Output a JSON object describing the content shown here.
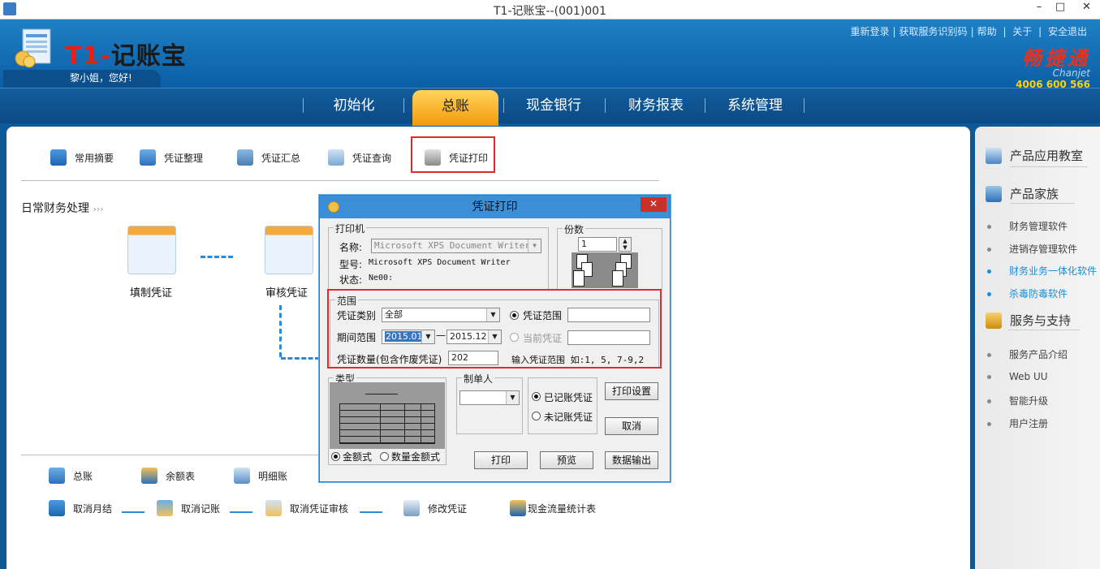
{
  "window": {
    "title": "T1-记账宝--(001)001",
    "minimize": "–",
    "maximize": "□",
    "close": "✕"
  },
  "header": {
    "brand_t1": "T1-",
    "brand_cn": "记账宝",
    "greeting": "黎小姐，您好!",
    "links": [
      "重新登录",
      "获取服务识别码",
      "帮助",
      "关于",
      "安全退出"
    ],
    "chanjet_cn": "畅捷通",
    "chanjet_en": "Chanjet",
    "phone": "4006 600 566"
  },
  "nav": {
    "items": [
      "初始化",
      "总账",
      "现金银行",
      "财务报表",
      "系统管理"
    ],
    "active": "总账"
  },
  "toolbar": {
    "items": [
      "常用摘要",
      "凭证整理",
      "凭证汇总",
      "凭证查询",
      "凭证打印"
    ]
  },
  "workflow": {
    "section_title": "日常财务处理",
    "fill": "填制凭证",
    "review": "审核凭证"
  },
  "quick": {
    "row1": [
      "总账",
      "余额表",
      "明细账"
    ],
    "row2": [
      "取消月结",
      "取消记账",
      "取消凭证审核",
      "修改凭证",
      "现金流量统计表"
    ]
  },
  "sidebar": {
    "classroom": "产品应用教室",
    "family": "产品家族",
    "family_items": [
      "财务管理软件",
      "进销存管理软件",
      "财务业务一体化软件",
      "杀毒防毒软件"
    ],
    "service": "服务与支持",
    "service_items": [
      "服务产品介绍",
      "Web UU",
      "智能升级",
      "用户注册"
    ]
  },
  "dialog": {
    "title": "凭证打印",
    "close": "✕",
    "printer_group": "打印机",
    "name_label": "名称:",
    "printer_name": "Microsoft XPS Document Writer",
    "model_label": "型号:",
    "model_value": "Microsoft XPS Document Writer",
    "status_label": "状态:",
    "status_value": "Ne00:",
    "copies_group": "份数",
    "copies_value": "1",
    "range_group": "范围",
    "voucher_type_label": "凭证类别",
    "voucher_type_value": "全部",
    "voucher_range_label": "凭证范围",
    "period_label": "期间范围",
    "period_from": "2015.01",
    "period_sep": "—",
    "period_to": "2015.12",
    "current_voucher_label": "当前凭证",
    "count_label": "凭证数量(包含作废凭证)",
    "count_value": "202",
    "hint": "输入凭证范围 如:1, 5, 7-9,2",
    "type_group": "类型",
    "type_amount": "金额式",
    "type_qty_amount": "数量金额式",
    "maker_group": "制单人",
    "posted": "已记账凭证",
    "unposted": "未记账凭证",
    "btn_print_setup": "打印设置",
    "btn_cancel": "取消",
    "btn_print": "打印",
    "btn_preview": "预览",
    "btn_export": "数据输出"
  }
}
